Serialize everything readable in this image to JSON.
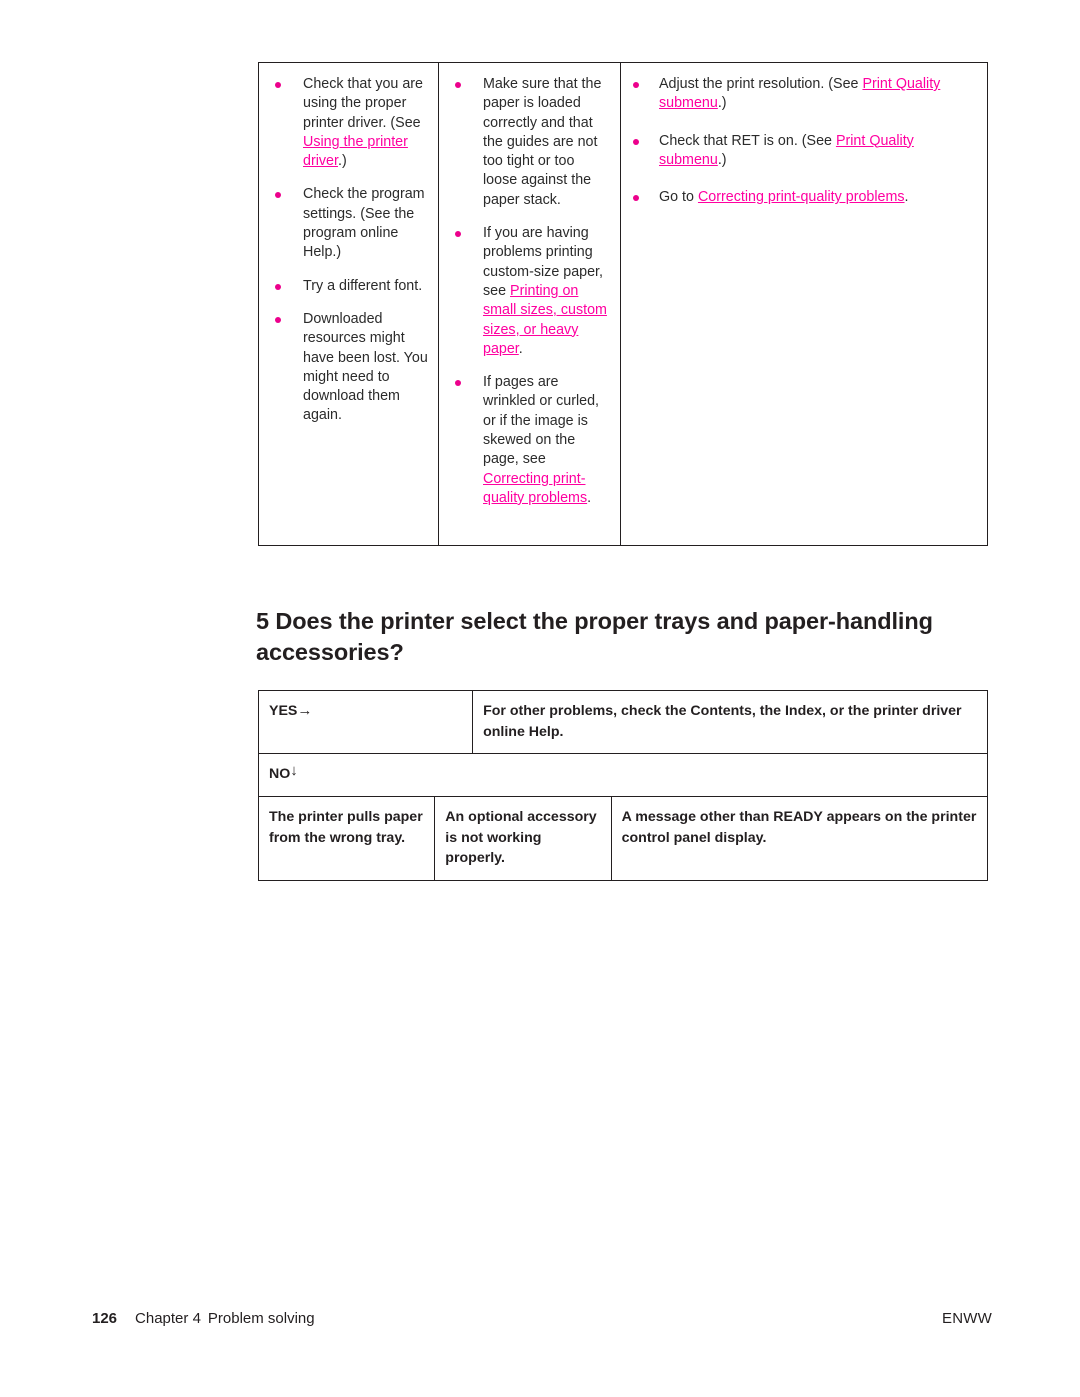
{
  "colors": {
    "link": "#ff00a0",
    "bullet": "#ec008c",
    "text": "#231f20",
    "border": "#231f20"
  },
  "top_table": {
    "columns": [
      {
        "items": [
          {
            "parts": [
              {
                "t": "text",
                "v": "Check that you are using the proper printer driver. (See "
              },
              {
                "t": "link",
                "v": "Using the printer driver"
              },
              {
                "t": "text",
                "v": ".)"
              }
            ]
          },
          {
            "parts": [
              {
                "t": "text",
                "v": "Check the program settings. (See the program online Help.)"
              }
            ]
          },
          {
            "parts": [
              {
                "t": "text",
                "v": "Try a different font."
              }
            ]
          },
          {
            "parts": [
              {
                "t": "text",
                "v": "Downloaded resources might have been lost. You might need to download them again."
              }
            ]
          }
        ]
      },
      {
        "items": [
          {
            "parts": [
              {
                "t": "text",
                "v": "Make sure that the paper is loaded correctly and that the guides are not too tight or too loose against the paper stack."
              }
            ]
          },
          {
            "parts": [
              {
                "t": "text",
                "v": "If you are having problems printing custom-size paper, see "
              },
              {
                "t": "link",
                "v": "Printing on small sizes, custom sizes, or heavy paper"
              },
              {
                "t": "text",
                "v": "."
              }
            ]
          },
          {
            "parts": [
              {
                "t": "text",
                "v": "If pages are wrinkled or curled, or if the image is skewed on the page, see "
              },
              {
                "t": "link",
                "v": "Correcting print-quality problems"
              },
              {
                "t": "text",
                "v": "."
              }
            ]
          }
        ]
      },
      {
        "items": [
          {
            "parts": [
              {
                "t": "text",
                "v": "Adjust the print resolution. (See "
              },
              {
                "t": "link",
                "v": "Print Quality submenu"
              },
              {
                "t": "text",
                "v": ".)"
              }
            ]
          },
          {
            "parts": [
              {
                "t": "text",
                "v": "Check that RET is on. (See "
              },
              {
                "t": "link",
                "v": "Print Quality submenu"
              },
              {
                "t": "text",
                "v": ".)"
              }
            ]
          },
          {
            "parts": [
              {
                "t": "text",
                "v": "Go to "
              },
              {
                "t": "link",
                "v": "Correcting print-quality problems"
              },
              {
                "t": "text",
                "v": "."
              }
            ]
          }
        ]
      }
    ]
  },
  "section": {
    "heading": "5 Does the printer select the proper trays and paper-handling accessories?"
  },
  "decision_table": {
    "yes_label": "YES",
    "yes_arrow": "→",
    "yes_answer": "For other problems, check the Contents, the Index, or the printer driver online Help.",
    "no_label": "NO",
    "no_arrow": "↓",
    "branches": [
      "The printer pulls paper from the wrong tray.",
      "An optional accessory is not working properly.",
      "A message other than READY appears on the printer control panel display."
    ]
  },
  "footer": {
    "page_number": "126",
    "chapter": "Chapter 4",
    "chapter_title": "Problem solving",
    "locale": "ENWW"
  }
}
